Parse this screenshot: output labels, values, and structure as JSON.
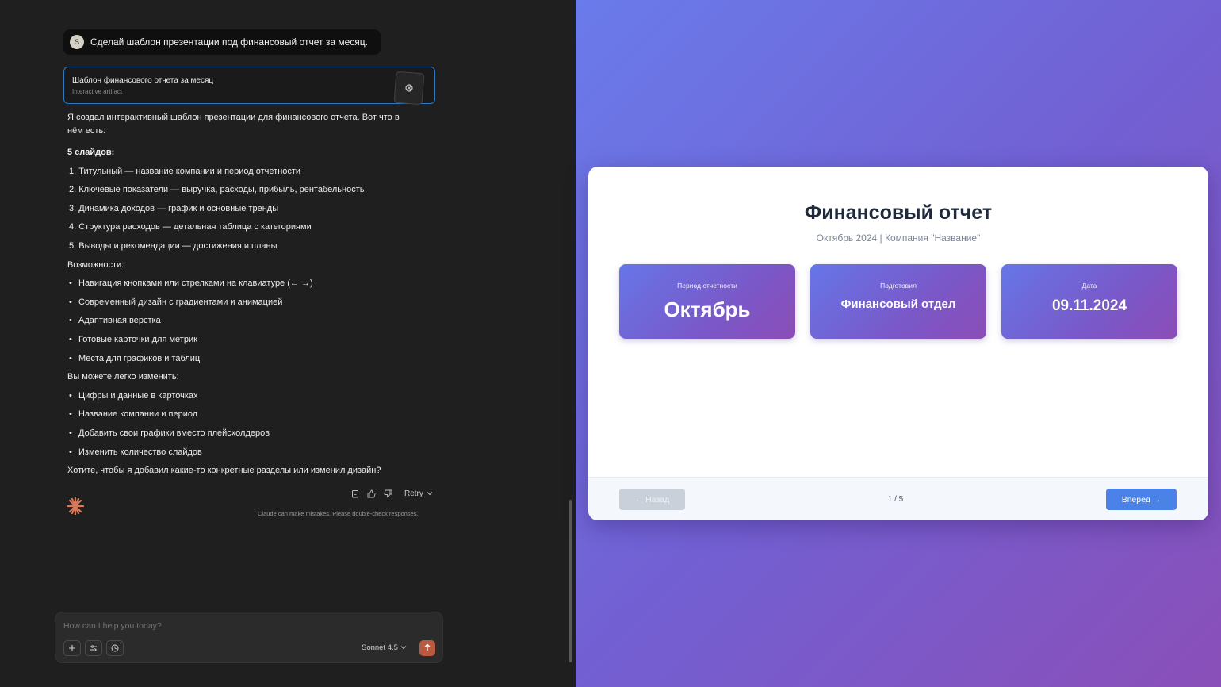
{
  "chat": {
    "user_avatar": "S",
    "user_message": "Сделай шаблон презентации под финансовый отчет за месяц.",
    "artifact": {
      "title": "Шаблон финансового отчета за месяц",
      "subtitle": "Interactive artifact",
      "thumb_icon": "code-icon"
    },
    "reply": {
      "intro": "Я создал интерактивный шаблон презентации для финансового отчета. Вот что в нём есть:",
      "slides_heading": "5 слайдов:",
      "slides": [
        "1. Титульный — название компании и период отчетности",
        "2. Ключевые показатели — выручка, расходы, прибыль, рентабельность",
        "3. Динамика доходов — график и основные тренды",
        "4. Структура расходов — детальная таблица с категориями",
        "5. Выводы и рекомендации — достижения и планы"
      ],
      "features_heading": "Возможности:",
      "features": [
        "Навигация кнопками или стрелками на клавиатуре (← →)",
        "Современный дизайн с градиентами и анимацией",
        "Адаптивная верстка",
        "Готовые карточки для метрик",
        "Места для графиков и таблиц"
      ],
      "edit_heading": "Вы можете легко изменить:",
      "edits": [
        "Цифры и данные в карточках",
        "Название компании и период",
        "Добавить свои графики вместо плейсхолдеров",
        "Изменить количество слайдов"
      ],
      "question": "Хотите, чтобы я добавил какие-то конкретные разделы или изменил дизайн?"
    },
    "actions": {
      "retry_label": "Retry",
      "icons": [
        "copy-icon",
        "thumbs-up-icon",
        "thumbs-down-icon"
      ]
    },
    "disclaimer": "Claude can make mistakes. Please double-check responses.",
    "composer": {
      "placeholder": "How can I help you today?",
      "model": "Sonnet 4.5"
    },
    "colors": {
      "accent": "#d97757",
      "background": "#1f1f1f"
    }
  },
  "slide": {
    "title": "Финансовый отчет",
    "subtitle": "Октябрь 2024 | Компания \"Название\"",
    "cards": [
      {
        "label": "Период отчетности",
        "value": "Октябрь"
      },
      {
        "label": "Подготовил",
        "value": "Финансовый отдел"
      },
      {
        "label": "Дата",
        "value": "09.11.2024"
      }
    ],
    "prev_label": "← Назад",
    "counter": "1 / 5",
    "next_label": "Вперед →",
    "colors": {
      "gradient_start": "#6a7bea",
      "gradient_end": "#8a4fb8",
      "next_button": "#4a82e8"
    }
  }
}
